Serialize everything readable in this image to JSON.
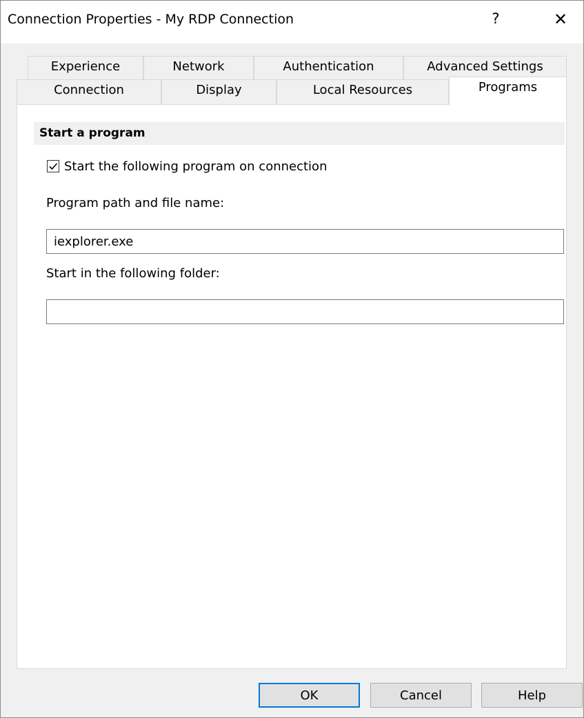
{
  "window": {
    "title": "Connection Properties - My RDP Connection",
    "help_glyph": "?",
    "close_glyph": "✕"
  },
  "tabs": {
    "back_row": [
      "Experience",
      "Network",
      "Authentication",
      "Advanced Settings"
    ],
    "front_row": [
      "Connection",
      "Display",
      "Local Resources",
      "Programs"
    ],
    "active": "Programs"
  },
  "programs": {
    "section_title": "Start a program",
    "start_checkbox_label": "Start the following program on connection",
    "start_checkbox_checked": true,
    "program_path_label": "Program path and file name:",
    "program_path_value": "iexplorer.exe",
    "start_folder_label": "Start in the following folder:",
    "start_folder_value": ""
  },
  "buttons": {
    "ok": "OK",
    "cancel": "Cancel",
    "help": "Help"
  },
  "colors": {
    "accent": "#0078d7",
    "dialog_bg": "#f0f0f0"
  }
}
